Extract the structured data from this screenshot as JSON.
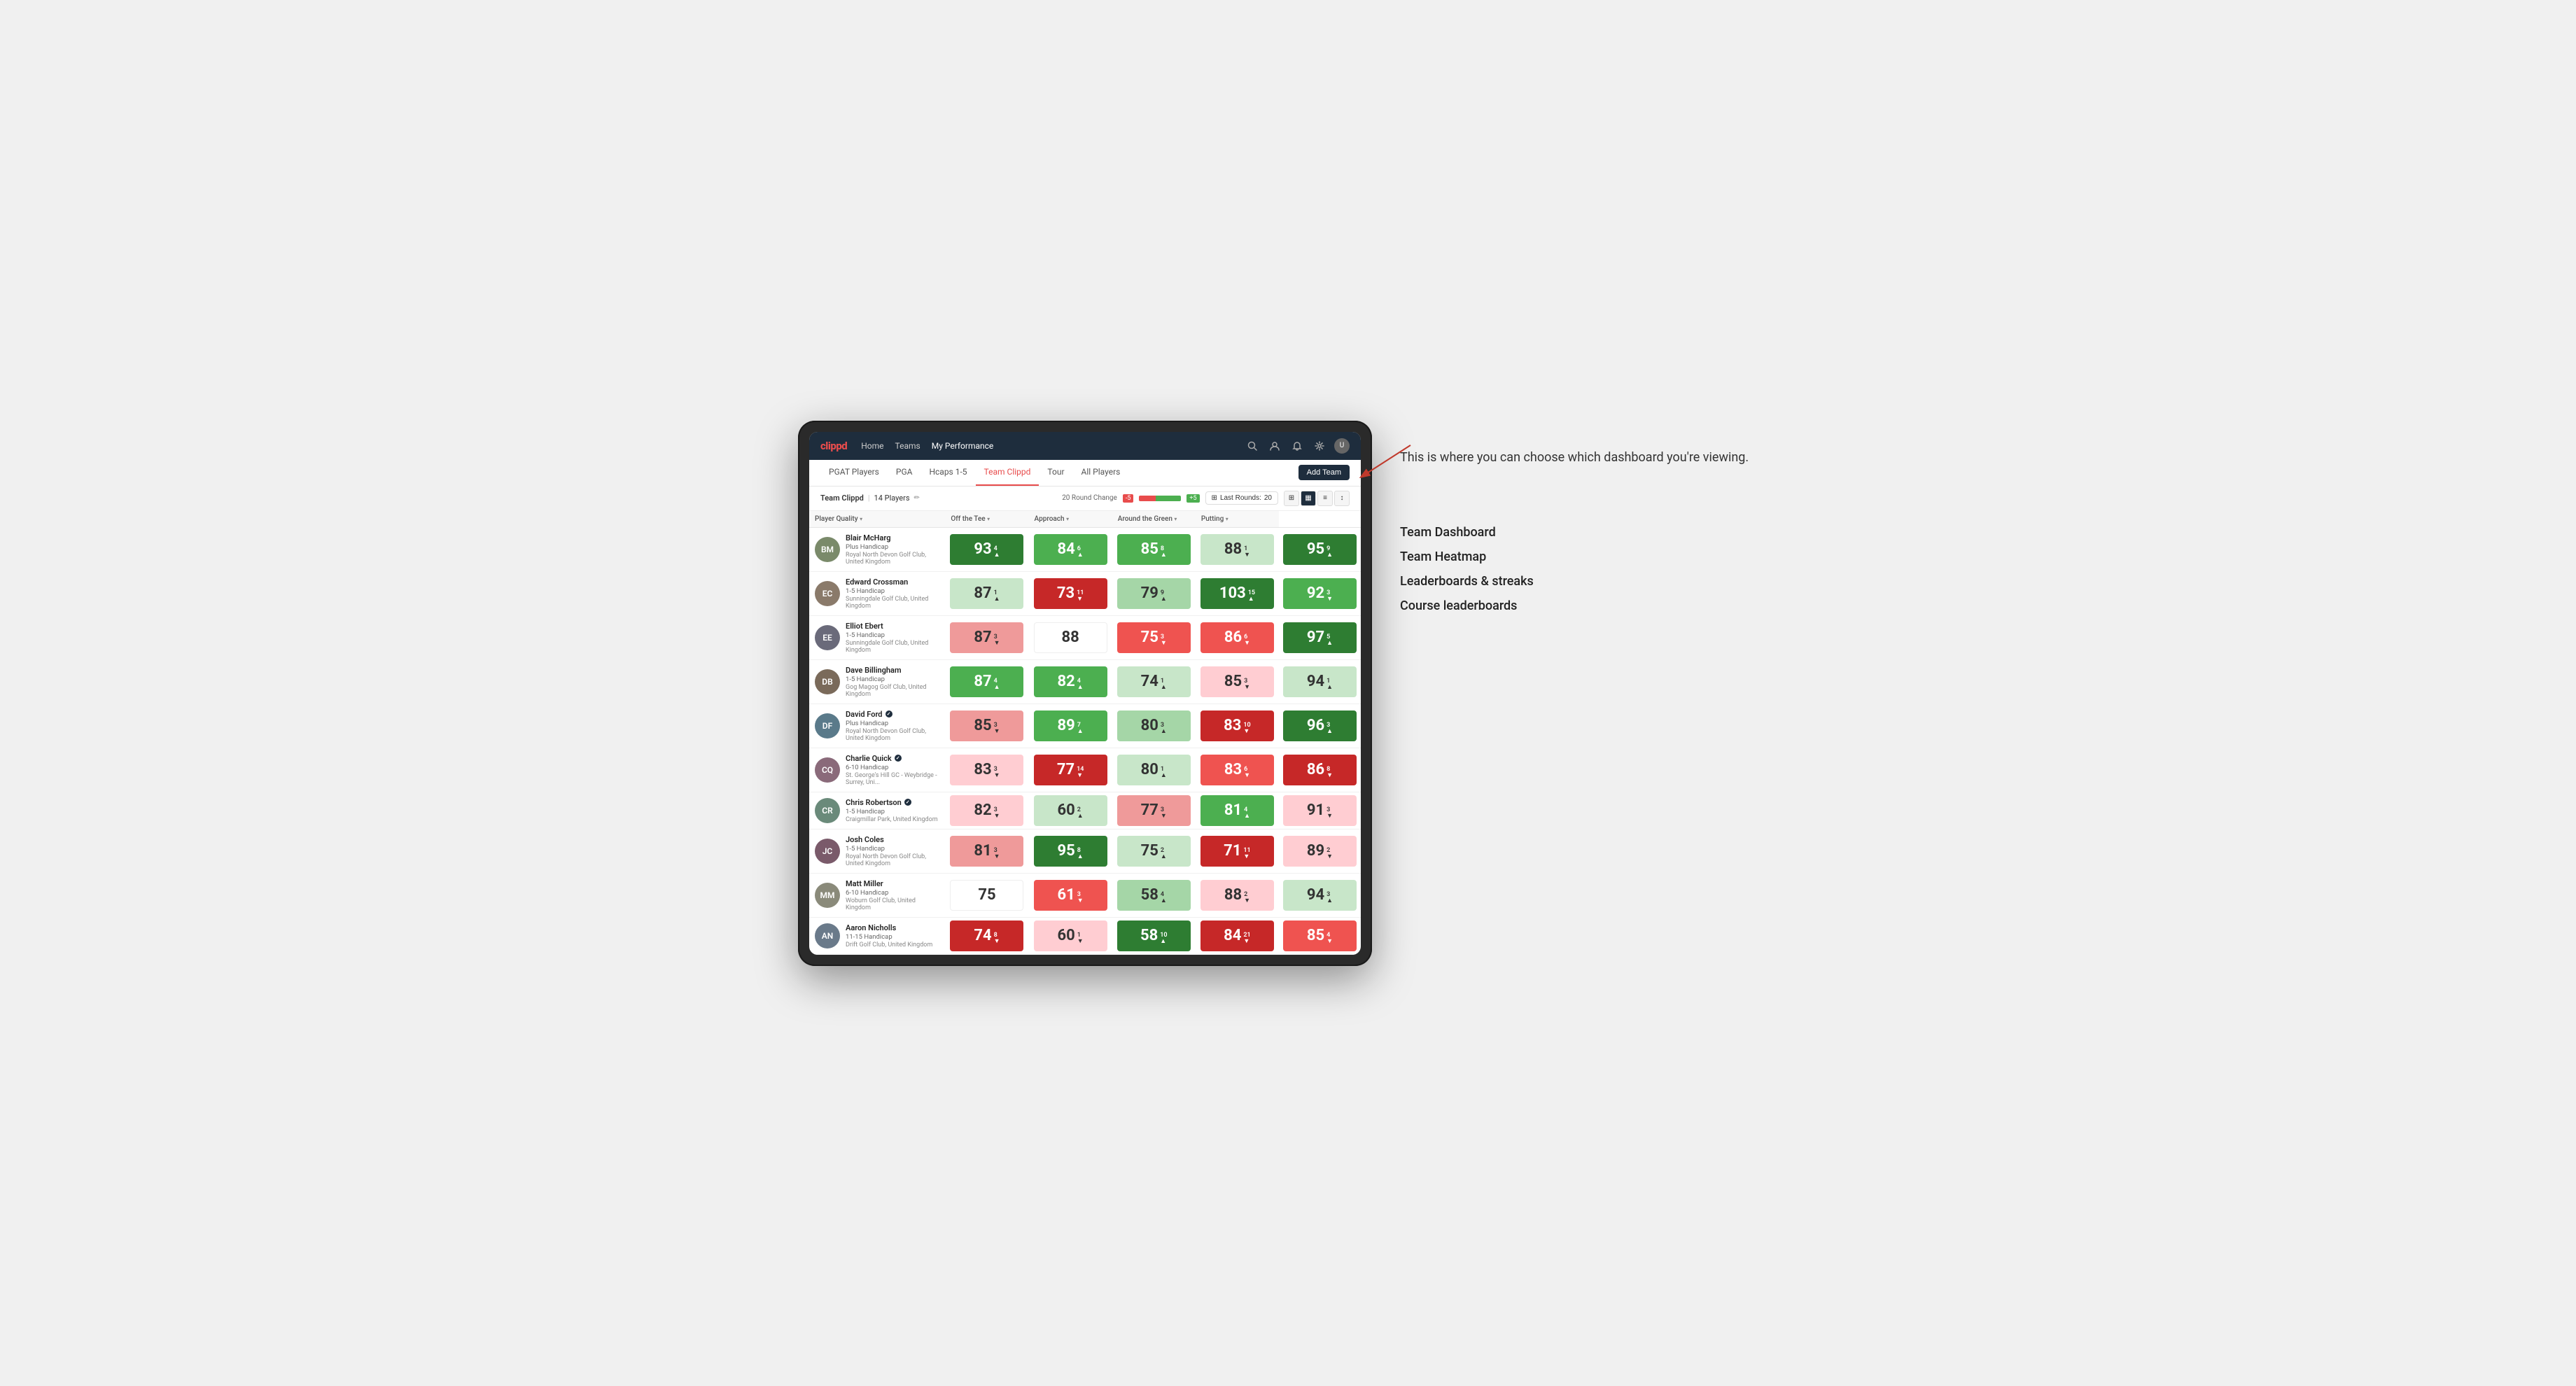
{
  "app": {
    "logo": "clippd",
    "nav": {
      "links": [
        "Home",
        "Teams",
        "My Performance"
      ],
      "active": "My Performance",
      "icons": [
        "search",
        "user",
        "bell",
        "settings",
        "avatar"
      ]
    },
    "subnav": {
      "links": [
        "PGAT Players",
        "PGA",
        "Hcaps 1-5",
        "Team Clippd",
        "Tour",
        "All Players"
      ],
      "active": "Team Clippd",
      "add_team_label": "Add Team"
    }
  },
  "team_bar": {
    "name": "Team Clippd",
    "separator": "|",
    "player_count": "14 Players",
    "round_change_label": "20 Round Change",
    "neg_change": "-5",
    "pos_change": "+5",
    "last_rounds_label": "Last Rounds:",
    "last_rounds_value": "20"
  },
  "table": {
    "columns": {
      "player": "Player Quality",
      "off_tee": "Off the Tee",
      "approach": "Approach",
      "around_green": "Around the Green",
      "putting": "Putting"
    },
    "players": [
      {
        "name": "Blair McHarg",
        "handicap": "Plus Handicap",
        "club": "Royal North Devon Golf Club, United Kingdom",
        "avatar_color": "#7a8a6a",
        "initials": "BM",
        "scores": {
          "quality": {
            "value": 93,
            "change": "4",
            "dir": "up",
            "color": "green-dark"
          },
          "off_tee": {
            "value": 84,
            "change": "6",
            "dir": "up",
            "color": "green-med"
          },
          "approach": {
            "value": 85,
            "change": "8",
            "dir": "up",
            "color": "green-med"
          },
          "around_green": {
            "value": 88,
            "change": "1",
            "dir": "down",
            "color": "green-pale"
          },
          "putting": {
            "value": 95,
            "change": "9",
            "dir": "up",
            "color": "green-dark"
          }
        }
      },
      {
        "name": "Edward Crossman",
        "handicap": "1-5 Handicap",
        "club": "Sunningdale Golf Club, United Kingdom",
        "avatar_color": "#8a7a6a",
        "initials": "EC",
        "scores": {
          "quality": {
            "value": 87,
            "change": "1",
            "dir": "up",
            "color": "green-pale"
          },
          "off_tee": {
            "value": 73,
            "change": "11",
            "dir": "down",
            "color": "red-dark"
          },
          "approach": {
            "value": 79,
            "change": "9",
            "dir": "up",
            "color": "green-light"
          },
          "around_green": {
            "value": 103,
            "change": "15",
            "dir": "up",
            "color": "green-dark"
          },
          "putting": {
            "value": 92,
            "change": "3",
            "dir": "down",
            "color": "green-med"
          }
        }
      },
      {
        "name": "Elliot Ebert",
        "handicap": "1-5 Handicap",
        "club": "Sunningdale Golf Club, United Kingdom",
        "avatar_color": "#6a6a7a",
        "initials": "EE",
        "scores": {
          "quality": {
            "value": 87,
            "change": "3",
            "dir": "down",
            "color": "red-light"
          },
          "off_tee": {
            "value": 88,
            "change": "",
            "dir": "none",
            "color": "neutral"
          },
          "approach": {
            "value": 75,
            "change": "3",
            "dir": "down",
            "color": "red-med"
          },
          "around_green": {
            "value": 86,
            "change": "6",
            "dir": "down",
            "color": "red-med"
          },
          "putting": {
            "value": 97,
            "change": "5",
            "dir": "up",
            "color": "green-dark"
          }
        }
      },
      {
        "name": "Dave Billingham",
        "handicap": "1-5 Handicap",
        "club": "Gog Magog Golf Club, United Kingdom",
        "avatar_color": "#7a6a5a",
        "initials": "DB",
        "scores": {
          "quality": {
            "value": 87,
            "change": "4",
            "dir": "up",
            "color": "green-med"
          },
          "off_tee": {
            "value": 82,
            "change": "4",
            "dir": "up",
            "color": "green-med"
          },
          "approach": {
            "value": 74,
            "change": "1",
            "dir": "up",
            "color": "green-pale"
          },
          "around_green": {
            "value": 85,
            "change": "3",
            "dir": "down",
            "color": "red-pale"
          },
          "putting": {
            "value": 94,
            "change": "1",
            "dir": "up",
            "color": "green-pale"
          }
        }
      },
      {
        "name": "David Ford",
        "handicap": "Plus Handicap",
        "club": "Royal North Devon Golf Club, United Kingdom",
        "avatar_color": "#5a7a8a",
        "initials": "DF",
        "verified": true,
        "scores": {
          "quality": {
            "value": 85,
            "change": "3",
            "dir": "down",
            "color": "red-light"
          },
          "off_tee": {
            "value": 89,
            "change": "7",
            "dir": "up",
            "color": "green-med"
          },
          "approach": {
            "value": 80,
            "change": "3",
            "dir": "up",
            "color": "green-light"
          },
          "around_green": {
            "value": 83,
            "change": "10",
            "dir": "down",
            "color": "red-dark"
          },
          "putting": {
            "value": 96,
            "change": "3",
            "dir": "up",
            "color": "green-dark"
          }
        }
      },
      {
        "name": "Charlie Quick",
        "handicap": "6-10 Handicap",
        "club": "St. George's Hill GC - Weybridge - Surrey, Uni...",
        "avatar_color": "#8a6a7a",
        "initials": "CQ",
        "verified": true,
        "scores": {
          "quality": {
            "value": 83,
            "change": "3",
            "dir": "down",
            "color": "red-pale"
          },
          "off_tee": {
            "value": 77,
            "change": "14",
            "dir": "down",
            "color": "red-dark"
          },
          "approach": {
            "value": 80,
            "change": "1",
            "dir": "up",
            "color": "green-pale"
          },
          "around_green": {
            "value": 83,
            "change": "6",
            "dir": "down",
            "color": "red-med"
          },
          "putting": {
            "value": 86,
            "change": "8",
            "dir": "down",
            "color": "red-dark"
          }
        }
      },
      {
        "name": "Chris Robertson",
        "handicap": "1-5 Handicap",
        "club": "Craigmillar Park, United Kingdom",
        "avatar_color": "#6a8a7a",
        "initials": "CR",
        "verified": true,
        "scores": {
          "quality": {
            "value": 82,
            "change": "3",
            "dir": "down",
            "color": "red-pale"
          },
          "off_tee": {
            "value": 60,
            "change": "2",
            "dir": "up",
            "color": "green-pale"
          },
          "approach": {
            "value": 77,
            "change": "3",
            "dir": "down",
            "color": "red-light"
          },
          "around_green": {
            "value": 81,
            "change": "4",
            "dir": "up",
            "color": "green-med"
          },
          "putting": {
            "value": 91,
            "change": "3",
            "dir": "down",
            "color": "red-pale"
          }
        }
      },
      {
        "name": "Josh Coles",
        "handicap": "1-5 Handicap",
        "club": "Royal North Devon Golf Club, United Kingdom",
        "avatar_color": "#7a5a6a",
        "initials": "JC",
        "scores": {
          "quality": {
            "value": 81,
            "change": "3",
            "dir": "down",
            "color": "red-light"
          },
          "off_tee": {
            "value": 95,
            "change": "8",
            "dir": "up",
            "color": "green-dark"
          },
          "approach": {
            "value": 75,
            "change": "2",
            "dir": "up",
            "color": "green-pale"
          },
          "around_green": {
            "value": 71,
            "change": "11",
            "dir": "down",
            "color": "red-dark"
          },
          "putting": {
            "value": 89,
            "change": "2",
            "dir": "down",
            "color": "red-pale"
          }
        }
      },
      {
        "name": "Matt Miller",
        "handicap": "6-10 Handicap",
        "club": "Woburn Golf Club, United Kingdom",
        "avatar_color": "#8a8a7a",
        "initials": "MM",
        "scores": {
          "quality": {
            "value": 75,
            "change": "",
            "dir": "none",
            "color": "neutral"
          },
          "off_tee": {
            "value": 61,
            "change": "3",
            "dir": "down",
            "color": "red-med"
          },
          "approach": {
            "value": 58,
            "change": "4",
            "dir": "up",
            "color": "green-light"
          },
          "around_green": {
            "value": 88,
            "change": "2",
            "dir": "down",
            "color": "red-pale"
          },
          "putting": {
            "value": 94,
            "change": "3",
            "dir": "up",
            "color": "green-pale"
          }
        }
      },
      {
        "name": "Aaron Nicholls",
        "handicap": "11-15 Handicap",
        "club": "Drift Golf Club, United Kingdom",
        "avatar_color": "#6a7a8a",
        "initials": "AN",
        "scores": {
          "quality": {
            "value": 74,
            "change": "8",
            "dir": "down",
            "color": "red-dark"
          },
          "off_tee": {
            "value": 60,
            "change": "1",
            "dir": "down",
            "color": "red-pale"
          },
          "approach": {
            "value": 58,
            "change": "10",
            "dir": "up",
            "color": "green-dark"
          },
          "around_green": {
            "value": 84,
            "change": "21",
            "dir": "down",
            "color": "red-dark"
          },
          "putting": {
            "value": 85,
            "change": "4",
            "dir": "down",
            "color": "red-med"
          }
        }
      }
    ]
  },
  "annotations": {
    "intro_text": "This is where you can choose which dashboard you're viewing.",
    "items": [
      "Team Dashboard",
      "Team Heatmap",
      "Leaderboards & streaks",
      "Course leaderboards"
    ]
  }
}
